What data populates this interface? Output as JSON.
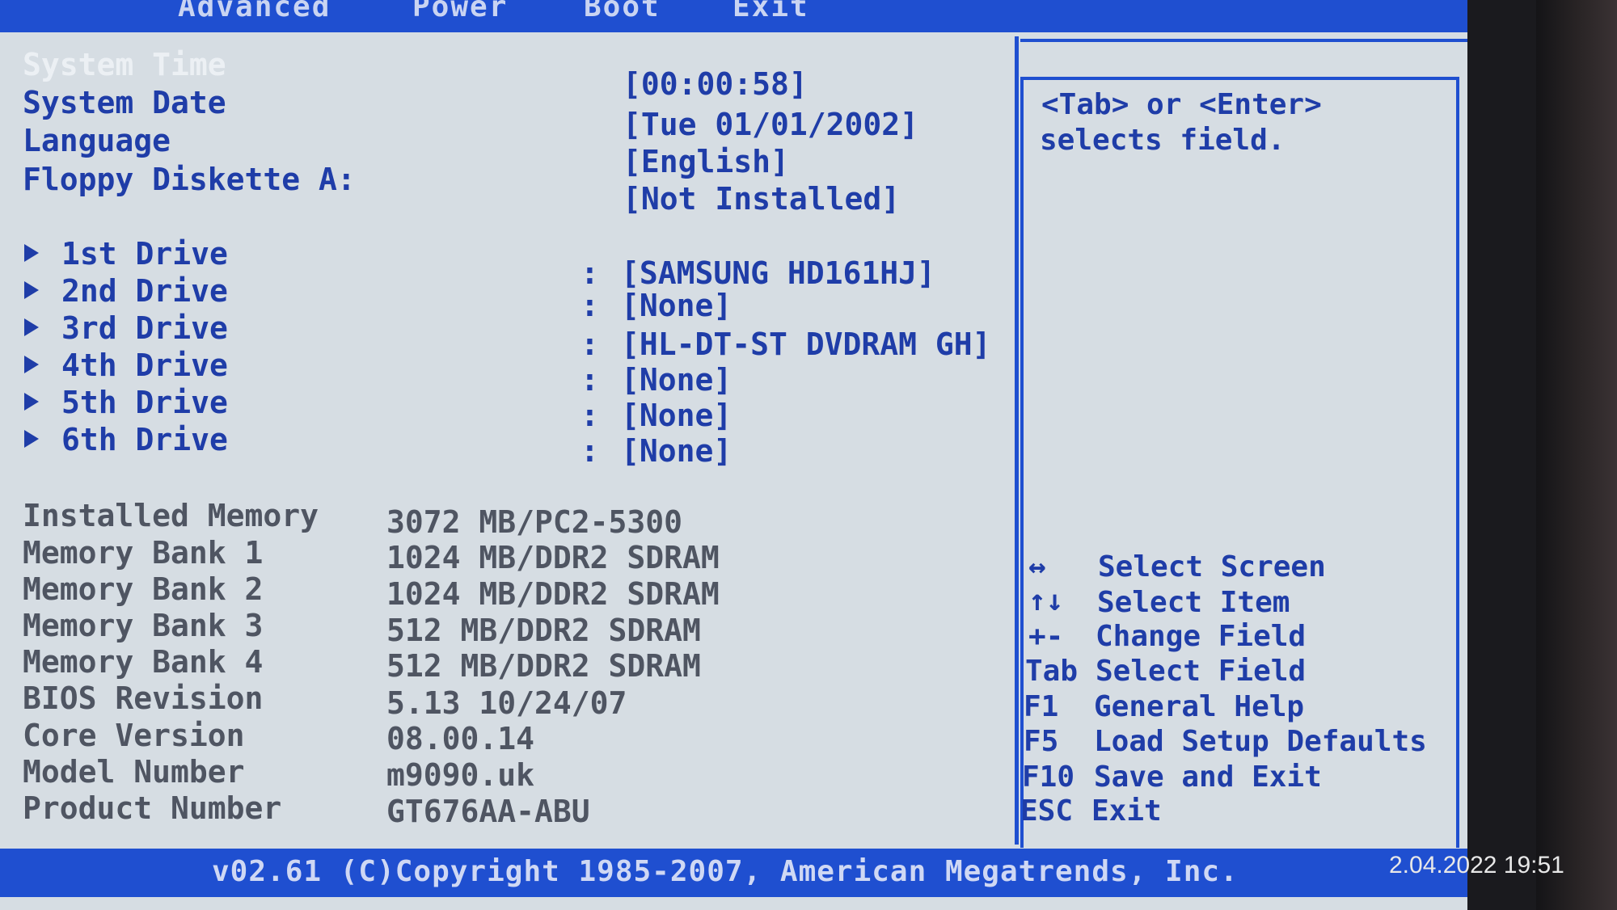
{
  "menu": {
    "items": [
      "Advanced",
      "Power",
      "Boot",
      "Exit"
    ]
  },
  "main": {
    "settings": [
      {
        "label": "System Time",
        "value": "[00:00:58]"
      },
      {
        "label": "System Date",
        "value": "[Tue 01/01/2002]"
      },
      {
        "label": "Language",
        "value": "[English]"
      },
      {
        "label": "Floppy Diskette A:",
        "value": "[Not Installed]"
      }
    ],
    "drives": [
      {
        "label": "1st Drive",
        "value": "[SAMSUNG HD161HJ]"
      },
      {
        "label": "2nd Drive",
        "value": "[None]"
      },
      {
        "label": "3rd Drive",
        "value": "[HL-DT-ST DVDRAM GH]"
      },
      {
        "label": "4th Drive",
        "value": "[None]"
      },
      {
        "label": "5th Drive",
        "value": "[None]"
      },
      {
        "label": "6th Drive",
        "value": "[None]"
      }
    ],
    "info": [
      {
        "label": "Installed Memory",
        "value": "3072 MB/PC2-5300"
      },
      {
        "label": "Memory Bank 1",
        "value": "1024 MB/DDR2 SDRAM"
      },
      {
        "label": "Memory Bank 2",
        "value": "1024 MB/DDR2 SDRAM"
      },
      {
        "label": "Memory Bank 3",
        "value": "512 MB/DDR2 SDRAM"
      },
      {
        "label": "Memory Bank 4",
        "value": "512 MB/DDR2 SDRAM"
      },
      {
        "label": "BIOS Revision",
        "value": "5.13 10/24/07"
      },
      {
        "label": "Core Version",
        "value": "08.00.14"
      },
      {
        "label": "Model Number",
        "value": "m9090.uk"
      },
      {
        "label": "Product Number",
        "value": "GT676AA-ABU"
      }
    ]
  },
  "help": {
    "line1": "<Tab> or <Enter>",
    "line2": "selects field."
  },
  "keys": [
    {
      "key": "↔",
      "action": "Select Screen"
    },
    {
      "key": "↑↓",
      "action": "Select Item"
    },
    {
      "key": "+-",
      "action": "Change Field"
    },
    {
      "key": "Tab",
      "action": "Select Field"
    },
    {
      "key": "F1",
      "action": "General Help"
    },
    {
      "key": "F5",
      "action": "Load Setup Defaults"
    },
    {
      "key": "F10",
      "action": "Save and Exit"
    },
    {
      "key": "ESC",
      "action": "Exit"
    }
  ],
  "footer": {
    "copyright": "v02.61 (C)Copyright 1985-2007, American Megatrends, Inc."
  },
  "photo_timestamp": "2.04.2022 19:51"
}
